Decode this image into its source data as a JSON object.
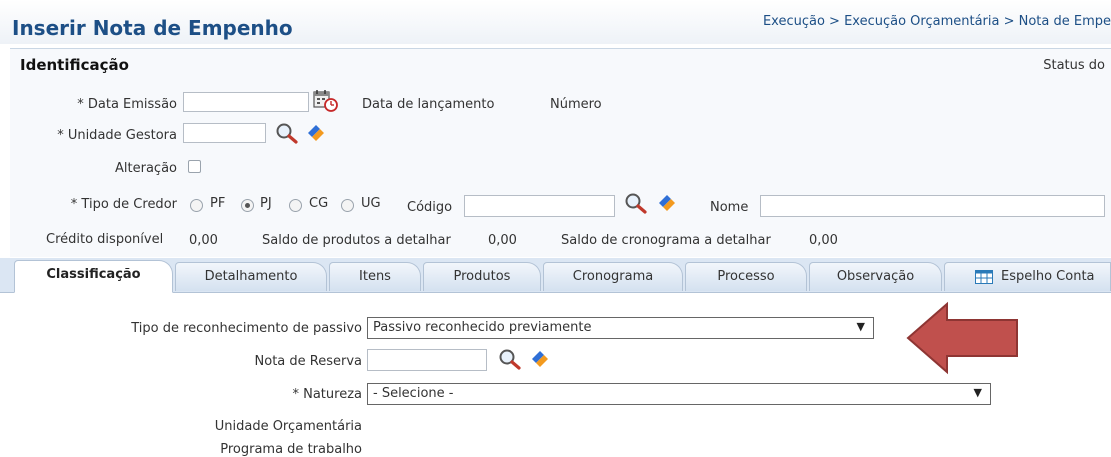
{
  "page": {
    "title": "Inserir Nota de Empenho",
    "breadcrumb": "Execução > Execução Orçamentária > Nota de Empe"
  },
  "identificacao": {
    "title": "Identificação",
    "status_label": "Status do",
    "data_emissao_label": "* Data Emissão",
    "data_lancamento_label": "Data de lançamento",
    "numero_label": "Número",
    "unidade_gestora_label": "* Unidade Gestora",
    "alteracao_label": "Alteração",
    "tipo_credor_label": "* Tipo de Credor",
    "credor_options": [
      "PF",
      "PJ",
      "CG",
      "UG"
    ],
    "credor_selected": "PJ",
    "codigo_label": "Código",
    "nome_label": "Nome",
    "credito_label": "Crédito disponível",
    "credito_value": "0,00",
    "saldo_produtos_label": "Saldo de produtos a detalhar",
    "saldo_produtos_value": "0,00",
    "saldo_cronograma_label": "Saldo de cronograma a detalhar",
    "saldo_cronograma_value": "0,00"
  },
  "tabs": [
    {
      "label": "Classificação",
      "active": true
    },
    {
      "label": "Detalhamento"
    },
    {
      "label": "Itens"
    },
    {
      "label": "Produtos"
    },
    {
      "label": "Cronograma"
    },
    {
      "label": "Processo"
    },
    {
      "label": "Observação"
    },
    {
      "label": "Espelho Conta"
    }
  ],
  "classificacao": {
    "tipo_reconhecimento_label": "Tipo de reconhecimento de passivo",
    "tipo_reconhecimento_value": "Passivo reconhecido previamente",
    "nota_reserva_label": "Nota de Reserva",
    "natureza_label": "* Natureza",
    "natureza_value": "- Selecione -",
    "unidade_orcamentaria_label": "Unidade Orçamentária",
    "programa_trabalho_label": "Programa de trabalho"
  },
  "icons": {
    "calendar": "calendar-icon",
    "search": "search-icon",
    "eraser": "eraser-icon",
    "table": "table-icon",
    "arrow": "arrow-left-icon"
  },
  "colors": {
    "title": "#1d4f86",
    "tab_bar": "#dbe6f3",
    "arrow": "#c0504d",
    "eraser_blue": "#2f6fd6",
    "eraser_orange": "#f39a1e"
  }
}
